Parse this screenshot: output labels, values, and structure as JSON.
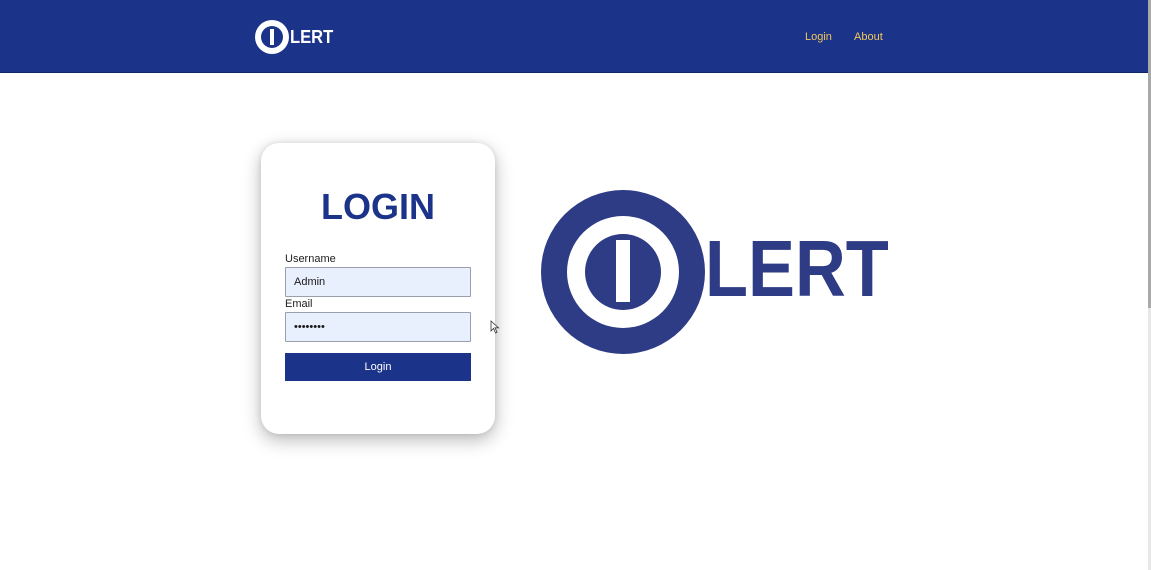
{
  "navbar": {
    "brand_text": "LERT",
    "links": [
      {
        "label": "Login"
      },
      {
        "label": "About"
      }
    ]
  },
  "login_card": {
    "title": "LOGIN",
    "username_label": "Username",
    "username_value": "Admin",
    "email_label": "Email",
    "email_value": "password",
    "button_label": "Login"
  },
  "hero_logo": {
    "text": "LERT"
  },
  "colors": {
    "brand_blue": "#1b3389",
    "logo_blue": "#2e3b85",
    "nav_link": "#f2c85b",
    "input_bg": "#e8effd"
  },
  "icons": {
    "brand_mark": "olert-logo-icon",
    "cursor": "mouse-cursor-icon"
  }
}
